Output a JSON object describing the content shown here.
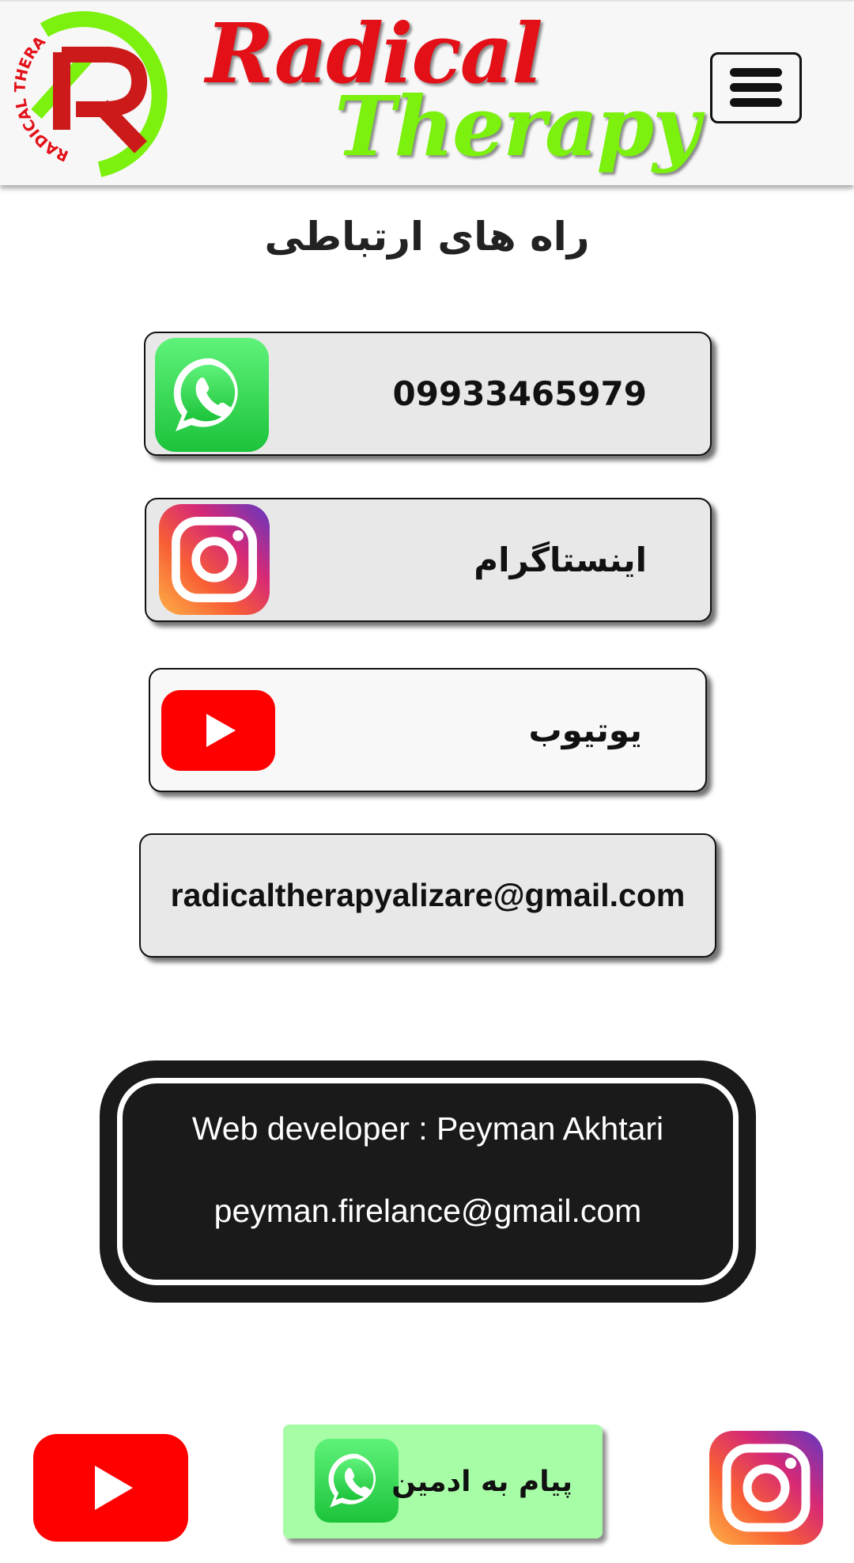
{
  "header": {
    "brand_line1": "Radical",
    "brand_line2": "Therapy",
    "logo_letter": "R",
    "logo_ring_text": "RADICAL THERAPY",
    "menu_icon": "hamburger-menu-icon"
  },
  "page_title": "راه های ارتباطی",
  "contacts": [
    {
      "label": "09933465979",
      "icon": "whatsapp-icon"
    },
    {
      "label": "اینستاگرام",
      "icon": "instagram-icon"
    },
    {
      "label": "یوتیوب",
      "icon": "youtube-icon"
    },
    {
      "label": "radicaltherapyalizare@gmail.com"
    }
  ],
  "developer": {
    "line1": "Web developer : Peyman Akhtari",
    "line2": "peyman.firelance@gmail.com"
  },
  "bottom_bar": {
    "admin_label": "پیام به ادمین",
    "left_icon": "youtube-icon",
    "center_icon": "whatsapp-icon",
    "right_icon": "instagram-icon"
  },
  "colors": {
    "brand_red": "#e31017",
    "brand_green": "#7bf10d",
    "whatsapp_green": "#25d366",
    "youtube_red": "#ff0000",
    "admin_button_bg": "#a6fda6",
    "footer_dark": "#1a1a1a"
  }
}
